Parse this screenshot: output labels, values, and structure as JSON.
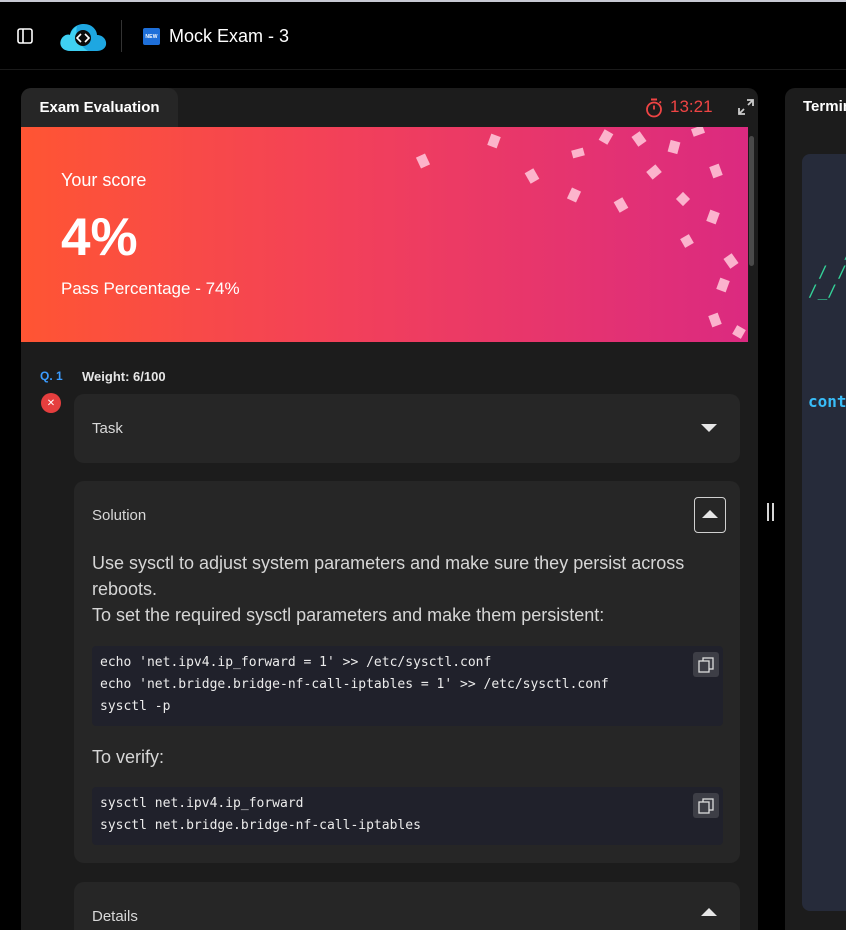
{
  "header": {
    "sidebar_icon": "sidebar-toggle-icon",
    "logo_icon": "code-cloud-logo",
    "badge_text": "NEW",
    "title": "Mock Exam - 3"
  },
  "left_panel": {
    "tab_label": "Exam Evaluation",
    "timer_icon": "stopwatch-icon",
    "timer": "13:21",
    "expand_icon": "expand-icon",
    "score": {
      "label": "Your score",
      "value": "4%",
      "pass_text": "Pass Percentage - 74%",
      "gradient": [
        "#ff5533",
        "#db2a80"
      ]
    },
    "question": {
      "number": "Q. 1",
      "weight": "Weight: 6/100",
      "status_icon": "wrong-x-icon",
      "status_mark": "✕",
      "status_color": "#e53e3e"
    },
    "task": {
      "title": "Task"
    },
    "solution": {
      "title": "Solution",
      "paragraph_lines": [
        "Use sysctl to adjust system parameters and make sure they persist across",
        "reboots.",
        "To set the required sysctl parameters and make them persistent:"
      ],
      "code1": [
        "echo 'net.ipv4.ip_forward = 1' >> /etc/sysctl.conf",
        "echo 'net.bridge.bridge-nf-call-iptables = 1' >> /etc/sysctl.conf",
        "sysctl -p"
      ],
      "verify_label": "To verify:",
      "code2": [
        "sysctl net.ipv4.ip_forward",
        "sysctl net.bridge.bridge-nf-call-iptables"
      ]
    },
    "details": {
      "title": "Details"
    }
  },
  "right_panel": {
    "tab_label": "Terminal",
    "ascii_lines": [
      " _",
      " /",
      " /",
      "/ /",
      "/_/"
    ],
    "prompt": "controlplane"
  },
  "colors": {
    "accent_blue": "#3b9cff",
    "timer_red": "#ef4444",
    "terminal_green": "#34d399",
    "prompt_cyan": "#38bdf8"
  }
}
